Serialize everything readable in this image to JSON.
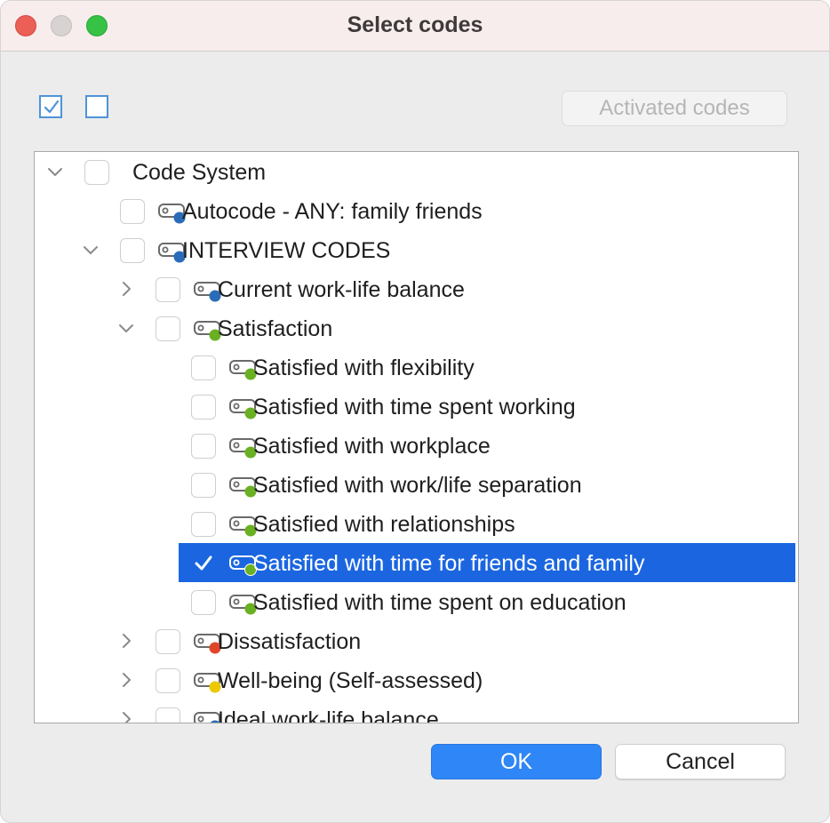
{
  "window": {
    "title": "Select codes"
  },
  "toolbar": {
    "select_all_icon": "checked-box-icon",
    "deselect_all_icon": "empty-box-icon",
    "activated_label": "Activated codes"
  },
  "tree": {
    "items": [
      {
        "label": "Code System",
        "level": 0,
        "expander": "down",
        "checked": false,
        "icon": "none"
      },
      {
        "label": "Autocode - ANY: family  friends",
        "level": 1,
        "expander": "none",
        "checked": false,
        "color": "#2b6cb8"
      },
      {
        "label": "INTERVIEW CODES",
        "level": 1,
        "expander": "down",
        "checked": false,
        "color": "#2b6cb8"
      },
      {
        "label": "Current work-life balance",
        "level": 2,
        "expander": "right",
        "checked": false,
        "color": "#2b6cb8"
      },
      {
        "label": "Satisfaction",
        "level": 2,
        "expander": "down",
        "checked": false,
        "color": "#6ab023"
      },
      {
        "label": "Satisfied with flexibility",
        "level": 3,
        "expander": "none",
        "checked": false,
        "color": "#6ab023"
      },
      {
        "label": "Satisfied with time spent working",
        "level": 3,
        "expander": "none",
        "checked": false,
        "color": "#6ab023"
      },
      {
        "label": "Satisfied with workplace",
        "level": 3,
        "expander": "none",
        "checked": false,
        "color": "#6ab023"
      },
      {
        "label": "Satisfied with work/life separation",
        "level": 3,
        "expander": "none",
        "checked": false,
        "color": "#6ab023"
      },
      {
        "label": "Satisfied with relationships",
        "level": 3,
        "expander": "none",
        "checked": false,
        "color": "#6ab023"
      },
      {
        "label": "Satisfied with time for friends and family",
        "level": 3,
        "expander": "none",
        "checked": true,
        "selected": true,
        "color": "#6ab023"
      },
      {
        "label": "Satisfied with time spent on education",
        "level": 3,
        "expander": "none",
        "checked": false,
        "color": "#6ab023"
      },
      {
        "label": "Dissatisfaction",
        "level": 2,
        "expander": "right",
        "checked": false,
        "color": "#e0452a"
      },
      {
        "label": "Well-being (Self-assessed)",
        "level": 2,
        "expander": "right",
        "checked": false,
        "color": "#ecc900"
      },
      {
        "label": "Ideal work-life balance",
        "level": 2,
        "expander": "right",
        "checked": false,
        "color": "#2b6cb8"
      }
    ]
  },
  "buttons": {
    "ok": "OK",
    "cancel": "Cancel"
  },
  "colors": {
    "selection": "#1b66e0",
    "ok_button": "#2f86f6",
    "checkbox_accent": "#4f93d9"
  }
}
